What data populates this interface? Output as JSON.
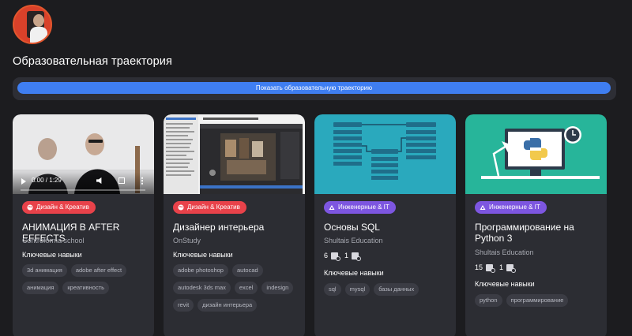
{
  "page_title": "Образовательная траектория",
  "trajectory_button": "Показать образовательную траекторию",
  "cards": [
    {
      "category": "Дизайн & Креатив",
      "title": "АНИМАЦИЯ В AFTER EFFECTS",
      "school": "Controforma school",
      "skills_header": "Ключевые навыки",
      "skills": [
        "3d анимация",
        "adobe after effect",
        "анимация",
        "креативность"
      ],
      "video_time": "0:00 / 1:29"
    },
    {
      "category": "Дизайн & Креатив",
      "title": "Дизайнер интерьера",
      "school": "OnStudy",
      "skills_header": "Ключевые навыки",
      "skills": [
        "adobe photoshop",
        "autocad",
        "autodesk 3ds max",
        "excel",
        "indesign",
        "revit",
        "дизайн интерьера"
      ]
    },
    {
      "category": "Инженерные & IT",
      "title": "Основы SQL",
      "school": "Shultais Education",
      "stat_a": "6",
      "stat_b": "1",
      "skills_header": "Ключевые навыки",
      "skills": [
        "sql",
        "mysql",
        "базы данных"
      ]
    },
    {
      "category": "Инженерные & IT",
      "title": "Программирование на Python 3",
      "school": "Shultais Education",
      "stat_a": "15",
      "stat_b": "1",
      "skills_header": "Ключевые навыки",
      "skills": [
        "python",
        "программирование"
      ]
    }
  ],
  "colors": {
    "background": "#1c1c1f",
    "card": "#2c2d33",
    "accent_blue": "#3f7ef1",
    "design_badge": "#e8424a",
    "it_badge": "#7d56e0",
    "sql_thumb": "#2aa9bd",
    "python_thumb": "#27b59a"
  }
}
